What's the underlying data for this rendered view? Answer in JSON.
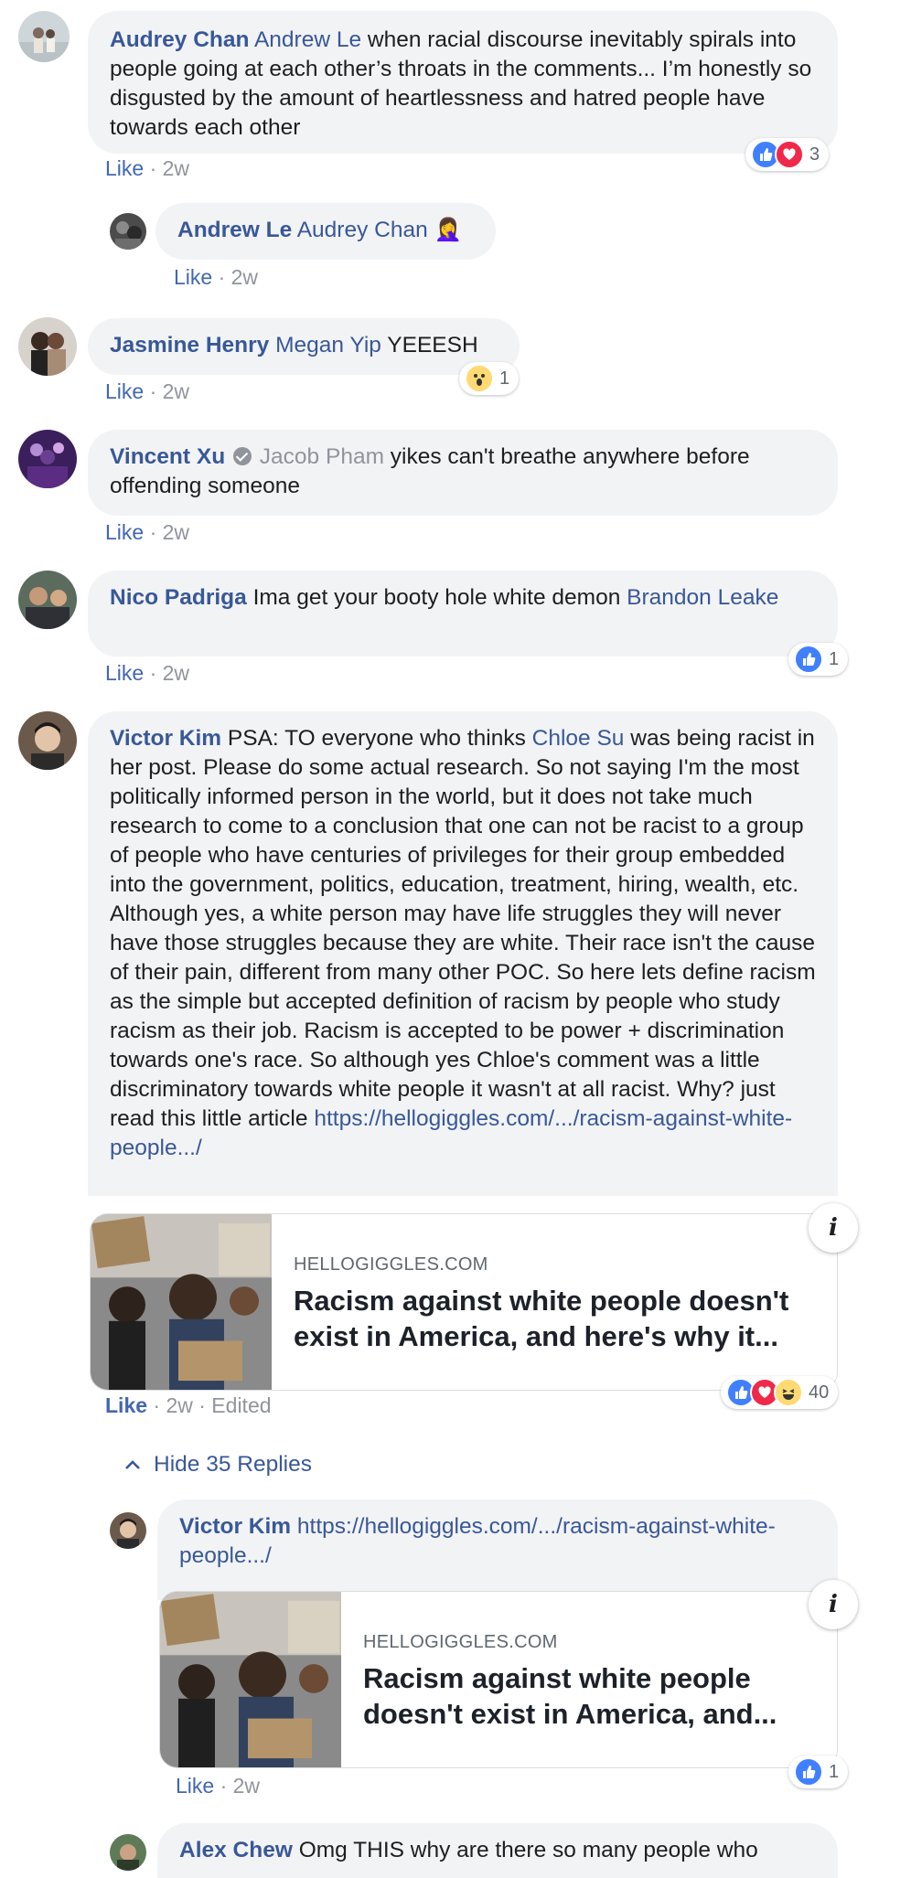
{
  "comments": {
    "c1": {
      "author": "Audrey Chan",
      "mention": "Andrew Le",
      "text": " when racial discourse inevitably spirals into people going at each other’s throats in the comments... I’m honestly so disgusted by the amount of heartlessness and hatred people have towards each other",
      "like_label": "Like",
      "time": " · 2w",
      "reaction_count": "3",
      "reactions": [
        "like-icon",
        "love-icon"
      ]
    },
    "c1r1": {
      "author": "Andrew Le",
      "mention": "Audrey Chan",
      "emoji": "🤦‍♀️",
      "like_label": "Like",
      "time": " · 2w"
    },
    "c2": {
      "author": "Jasmine Henry",
      "mention": "Megan Yip",
      "text": " YEEESH",
      "like_label": "Like",
      "time": " · 2w",
      "reaction_count": "1",
      "reactions": [
        "wow-icon"
      ]
    },
    "c3": {
      "author": "Vincent Xu",
      "mention": "Jacob Pham",
      "text": " yikes can't breathe anywhere before offending someone",
      "like_label": "Like",
      "time": " · 2w"
    },
    "c4": {
      "author": "Nico Padriga",
      "text": " Ima get your booty hole white demon ",
      "mention": "Brandon Leake",
      "like_label": "Like",
      "time": " · 2w",
      "reaction_count": "1",
      "reactions": [
        "like-icon"
      ]
    },
    "c5": {
      "author": "Victor Kim",
      "text_a": " PSA: TO everyone who thinks ",
      "mention": "Chloe Su",
      "text_b": " was being racist in her post. Please do some actual research. So not saying I'm the most politically informed person in the world, but it does not take much research to come to a conclusion that one can not be racist to a group of people who have centuries of privileges for their group embedded into the government, politics, education, treatment, hiring, wealth, etc. Although yes, a white person may have life struggles they will never have those struggles because they are white. Their race isn't the cause of their pain, different from many other POC. So here lets define racism as the simple but accepted definition of racism by people who study racism as their job. Racism is accepted to be power + discrimination towards one's race. So although yes Chloe's comment was a little discriminatory towards white people it wasn't at all racist. Why? just read this little article",
      "url": "https://hellogiggles.com/.../racism-against-white-people.../",
      "card_domain": "HELLOGIGGLES.COM",
      "card_title": "Racism against white people doesn't exist in America, and here's why it...",
      "like_label": "Like",
      "time": " · 2w · Edited",
      "reaction_count": "40",
      "reactions": [
        "like-icon",
        "love-icon",
        "haha-icon"
      ],
      "hide_replies": "Hide 35 Replies"
    },
    "c5r1": {
      "author": "Victor Kim",
      "url": "https://hellogiggles.com/.../racism-against-white-people.../",
      "card_domain": "HELLOGIGGLES.COM",
      "card_title": "Racism against white people doesn't exist in America, and...",
      "like_label": "Like",
      "time": " · 2w",
      "reaction_count": "1",
      "reactions": [
        "like-icon"
      ]
    },
    "c5r2": {
      "author": "Alex Chew",
      "text": " Omg THIS why are there so many people who"
    }
  },
  "info_icon_label": "i",
  "colors": {
    "link_blue": "#385898",
    "bubble_bg": "#f2f3f5",
    "like_blue": "#4080ff",
    "love_red": "#f0284a",
    "haha_yellow": "#ffd972"
  }
}
